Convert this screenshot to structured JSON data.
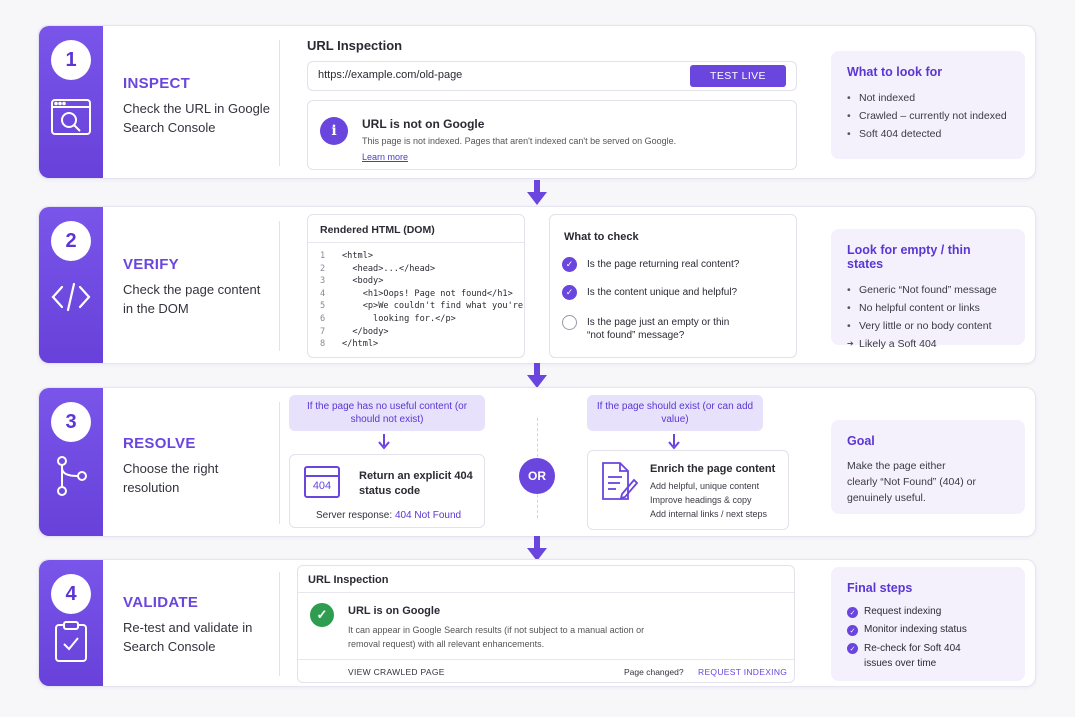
{
  "steps": [
    {
      "num": "1",
      "title": "INSPECT",
      "desc": "Check the URL in Google Search Console"
    },
    {
      "num": "2",
      "title": "VERIFY",
      "desc": "Check the page content in the DOM"
    },
    {
      "num": "3",
      "title": "RESOLVE",
      "desc": "Choose the right resolution"
    },
    {
      "num": "4",
      "title": "VALIDATE",
      "desc": "Re-test and validate in Search Console"
    }
  ],
  "inspect": {
    "heading": "URL Inspection",
    "url_value": "https://example.com/old-page",
    "test_live": "TEST LIVE",
    "status_title": "URL is not on Google",
    "status_text": "This page is not indexed. Pages that aren't indexed can't be served on Google.",
    "learn_more": "Learn more",
    "panel_title": "What to look for",
    "panel_items": [
      "Not indexed",
      "Crawled – currently not indexed",
      "Soft 404 detected"
    ]
  },
  "verify": {
    "code_title": "Rendered HTML (DOM)",
    "code_lines": [
      {
        "n": "1",
        "code": "<html>"
      },
      {
        "n": "2",
        "code": "  <head>...</head>"
      },
      {
        "n": "3",
        "code": "  <body>"
      },
      {
        "n": "4",
        "code": "    <h1>Oops! Page not found</h1>"
      },
      {
        "n": "5",
        "code": "    <p>We couldn't find what you're"
      },
      {
        "n": "6",
        "code": "      looking for.</p>"
      },
      {
        "n": "7",
        "code": "  </body>"
      },
      {
        "n": "8",
        "code": "</html>"
      }
    ],
    "check_title": "What to check",
    "checks": [
      {
        "text": "Is the page returning real content?",
        "checked": true
      },
      {
        "text": "Is the content unique and helpful?",
        "checked": true
      },
      {
        "text": "Is the page just an empty or thin “not found” message?",
        "checked": false
      }
    ],
    "panel_title": "Look for empty / thin states",
    "panel_items": [
      "Generic “Not found” message",
      "No helpful content or links",
      "Very little or no body content"
    ],
    "panel_arrow_item": "Likely a Soft 404"
  },
  "resolve": {
    "left_condition": "If the page has no useful content (or should not exist)",
    "right_condition": "If the page should exist (or can add value)",
    "left_badge": "404",
    "left_title": "Return an explicit 404 status code",
    "server_label": "Server response:",
    "server_value": "404 Not Found",
    "or": "OR",
    "right_title": "Enrich the page content",
    "right_items": [
      "Add helpful, unique content",
      "Improve headings & copy",
      "Add internal links / next steps"
    ],
    "panel_title": "Goal",
    "panel_text": "Make the page either clearly “Not Found” (404) or genuinely useful."
  },
  "validate": {
    "heading": "URL Inspection",
    "status_title": "URL is on Google",
    "status_text": "It can appear in Google Search results (if not subject to a manual action or removal request) with all relevant enhancements.",
    "view_crawled": "VIEW CRAWLED PAGE",
    "page_changed": "Page changed?",
    "request_indexing": "REQUEST INDEXING",
    "panel_title": "Final steps",
    "panel_items": [
      "Request indexing",
      "Monitor indexing status",
      "Re-check for Soft 404 issues over time"
    ]
  },
  "colors": {
    "accent": "#6a45de",
    "success": "#2e9d4f"
  }
}
